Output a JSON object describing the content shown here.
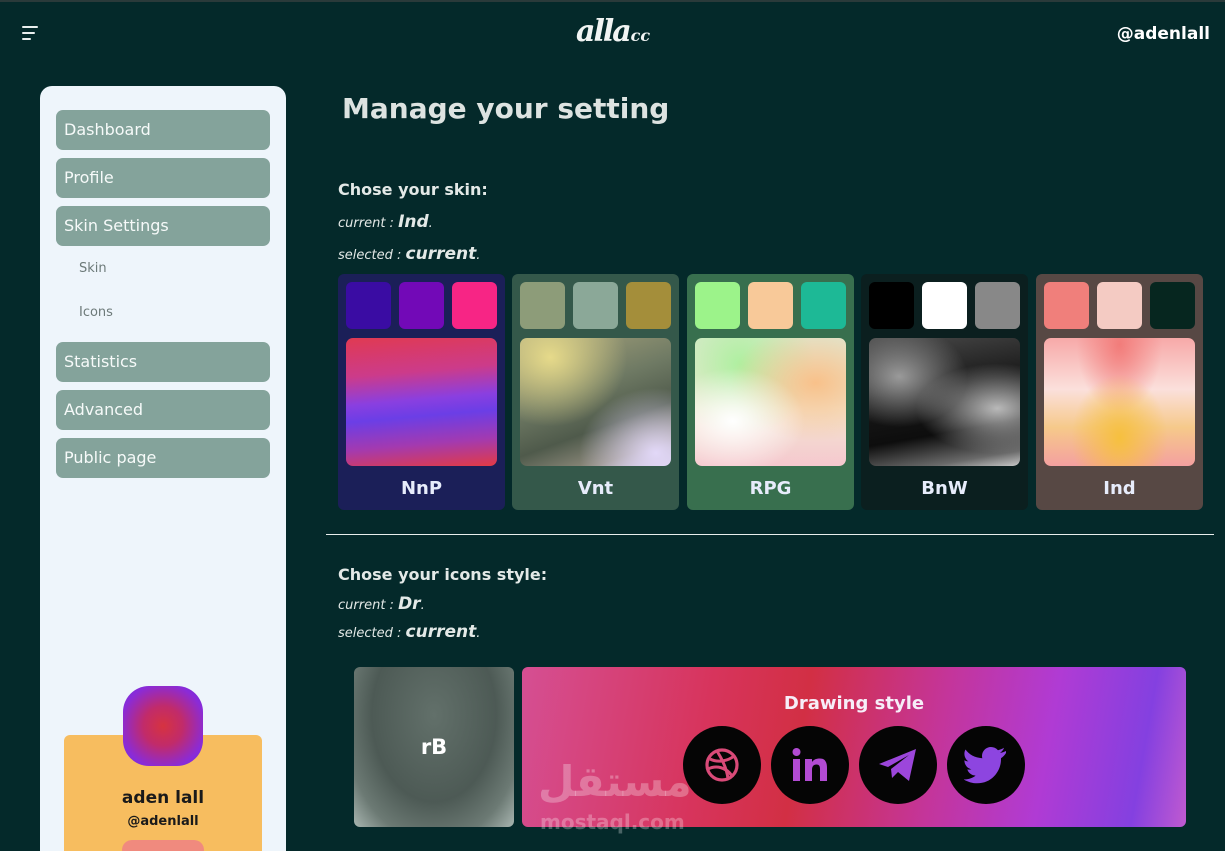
{
  "header": {
    "logo_main": "alla",
    "logo_suffix": "cc",
    "username": "@adenlall"
  },
  "sidebar": {
    "items": [
      {
        "label": "Dashboard"
      },
      {
        "label": "Profile"
      },
      {
        "label": "Skin Settings"
      },
      {
        "label": "Statistics"
      },
      {
        "label": "Advanced"
      },
      {
        "label": "Public page"
      }
    ],
    "subitems": [
      {
        "label": "Skin"
      },
      {
        "label": "Icons"
      }
    ],
    "user": {
      "name": "aden lall",
      "handle": "@adenlall"
    }
  },
  "main": {
    "title": "Manage your setting",
    "skin_section": {
      "title": "Chose your skin:",
      "current_prefix": "current : ",
      "current_value": "Ind",
      "selected_prefix": "selected : ",
      "selected_value": "current"
    },
    "skins": [
      {
        "name": "NnP",
        "bg": "#1b1f58",
        "swatches": [
          "#3a0ca3",
          "#7209b7",
          "#f72585"
        ]
      },
      {
        "name": "Vnt",
        "bg": "#34584a",
        "swatches": [
          "#8d9c79",
          "#8ba898",
          "#a48e3a"
        ]
      },
      {
        "name": "RPG",
        "bg": "#386f4e",
        "swatches": [
          "#9cf38a",
          "#f8c999",
          "#1db996"
        ]
      },
      {
        "name": "BnW",
        "bg": "#0b1f1f",
        "swatches": [
          "#000000",
          "#ffffff",
          "#888888"
        ]
      },
      {
        "name": "Ind",
        "bg": "#574844",
        "swatches": [
          "#f07f7b",
          "#f4cbc3",
          "#06261f"
        ]
      }
    ],
    "icons_section": {
      "title": "Chose your icons style:",
      "current_prefix": "current : ",
      "current_value": "Dr",
      "selected_prefix": "selected : ",
      "selected_value": "current"
    },
    "icon_styles": {
      "left_label": "rB",
      "right_label": "Drawing style",
      "social_icons": [
        "dribbble-icon",
        "linkedin-icon",
        "telegram-icon",
        "twitter-icon"
      ]
    }
  },
  "watermark": {
    "arabic": "مستقل",
    "latin": "mostaql.com"
  }
}
